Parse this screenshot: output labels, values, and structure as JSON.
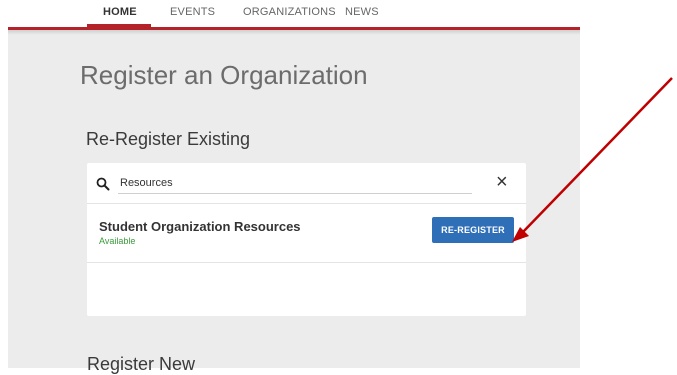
{
  "nav": {
    "tabs": [
      {
        "label": "HOME",
        "active": true
      },
      {
        "label": "EVENTS",
        "active": false
      },
      {
        "label": "ORGANIZATIONS",
        "active": false
      },
      {
        "label": "NEWS",
        "active": false
      }
    ]
  },
  "page": {
    "title": "Register an Organization",
    "section_existing": "Re-Register Existing",
    "section_new": "Register New"
  },
  "search": {
    "value": "Resources",
    "icon": "search-icon",
    "clear_icon": "close-icon"
  },
  "result": {
    "name": "Student Organization Resources",
    "status": "Available",
    "button_label": "RE-REGISTER"
  },
  "colors": {
    "brand_red": "#b4232a",
    "button_blue": "#2f6fb8",
    "status_green": "#3a9a3a",
    "annotation_arrow": "#c00000"
  }
}
